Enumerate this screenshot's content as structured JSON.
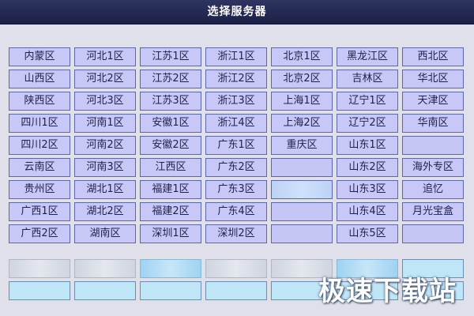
{
  "window": {
    "title": "选择服务器"
  },
  "servers": [
    [
      "内蒙区",
      "河北1区",
      "江苏1区",
      "浙江1区",
      "北京1区",
      "黑龙江区",
      "西北区"
    ],
    [
      "山西区",
      "河北2区",
      "江苏2区",
      "浙江2区",
      "北京2区",
      "吉林区",
      "华北区"
    ],
    [
      "陕西区",
      "河北3区",
      "江苏3区",
      "浙江3区",
      "上海1区",
      "辽宁1区",
      "天津区"
    ],
    [
      "四川1区",
      "河南1区",
      "安徽1区",
      "浙江4区",
      "上海2区",
      "辽宁2区",
      "华南区"
    ],
    [
      "四川2区",
      "河南2区",
      "安徽2区",
      "广东1区",
      "重庆区",
      "山东1区",
      ""
    ],
    [
      "云南区",
      "河南3区",
      "江西区",
      "广东2区",
      "",
      "山东2区",
      "海外专区"
    ],
    [
      "贵州区",
      "湖北1区",
      "福建1区",
      "广东3区",
      "",
      "山东3区",
      "追忆"
    ],
    [
      "广西1区",
      "湖北2区",
      "福建2区",
      "广东4区",
      "",
      "山东4区",
      "月光宝盒"
    ],
    [
      "广西2区",
      "湖南区",
      "深圳1区",
      "深圳2区",
      "",
      "山东5区",
      ""
    ]
  ],
  "watermark": "极速下载站"
}
